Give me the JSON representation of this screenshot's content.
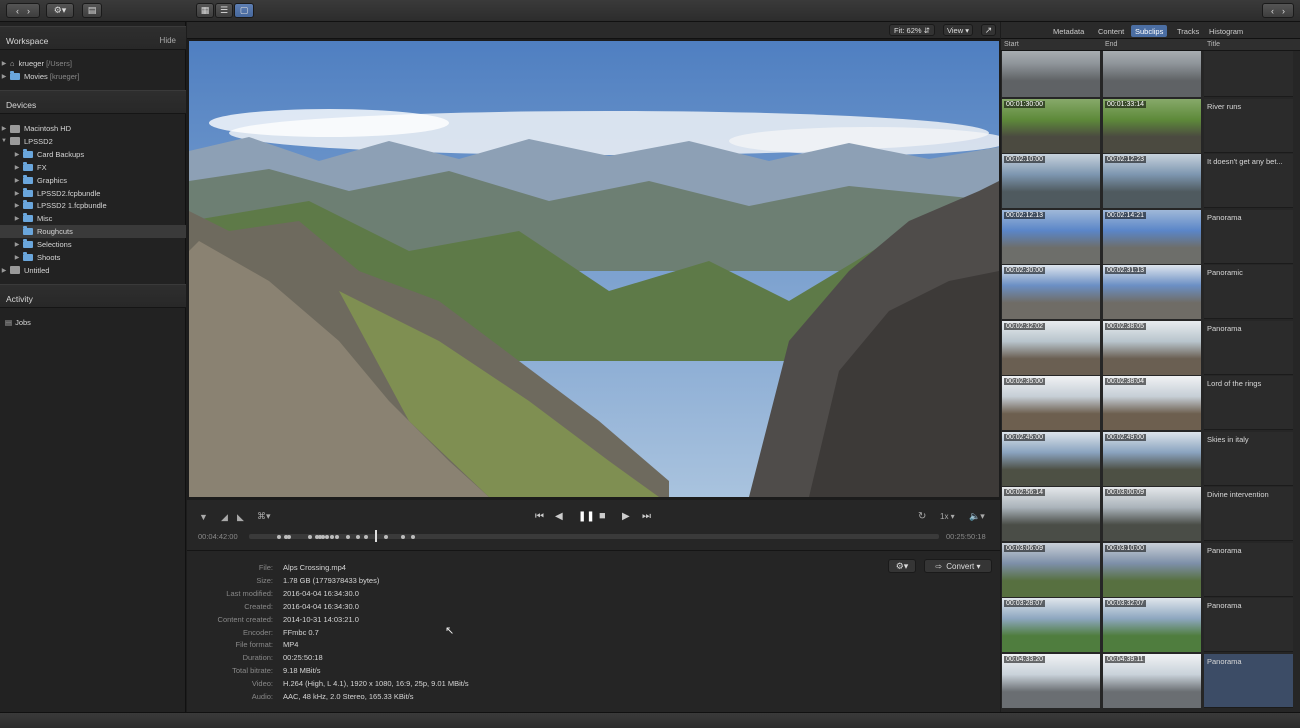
{
  "toolbar": {
    "view_buttons": [
      "grid-view",
      "list-view",
      "viewer-view"
    ]
  },
  "sidebar": {
    "workspace": {
      "title": "Workspace",
      "hide_label": "Hide",
      "items": [
        {
          "name": "krueger",
          "path": "[/Users]"
        },
        {
          "name": "Movies",
          "path": "[krueger]"
        }
      ]
    },
    "devices": {
      "title": "Devices",
      "items": [
        {
          "label": "Macintosh HD",
          "level": 0,
          "icon": "disk"
        },
        {
          "label": "LPSSD2",
          "level": 0,
          "icon": "disk"
        },
        {
          "label": "Card Backups",
          "level": 1,
          "icon": "folder"
        },
        {
          "label": "FX",
          "level": 1,
          "icon": "folder"
        },
        {
          "label": "Graphics",
          "level": 1,
          "icon": "folder"
        },
        {
          "label": "LPSSD2.fcpbundle",
          "level": 1,
          "icon": "folder"
        },
        {
          "label": "LPSSD2 1.fcpbundle",
          "level": 1,
          "icon": "folder"
        },
        {
          "label": "Misc",
          "level": 1,
          "icon": "folder"
        },
        {
          "label": "Roughcuts",
          "level": 1,
          "icon": "folder"
        },
        {
          "label": "Selections",
          "level": 1,
          "icon": "folder"
        },
        {
          "label": "Shoots",
          "level": 1,
          "icon": "folder"
        },
        {
          "label": "Untitled",
          "level": 0,
          "icon": "disk"
        }
      ]
    },
    "activity": {
      "title": "Activity"
    },
    "jobs": {
      "label": "Jobs"
    }
  },
  "viewer": {
    "fit_label": "Fit: 62%",
    "view_label": "View",
    "current_time": "00:04:42:00",
    "duration_time": "00:25:50:18",
    "speed_label": "1x",
    "playhead_fraction": 0.182
  },
  "file_info": {
    "convert_label": "Convert",
    "fields": [
      {
        "label": "File:",
        "value": "Alps Crossing.mp4"
      },
      {
        "label": "Size:",
        "value": "1.78 GB (1779378433 bytes)"
      },
      {
        "label": "Last modified:",
        "value": "2016-04-04 16:34:30.0"
      },
      {
        "label": "Created:",
        "value": "2016-04-04 16:34:30.0"
      },
      {
        "label": "Content created:",
        "value": "2014-10-31 14:03:21.0"
      },
      {
        "label": "Encoder:",
        "value": "FFmbc 0.7"
      },
      {
        "label": "File format:",
        "value": "MP4"
      },
      {
        "label": "Duration:",
        "value": "00:25:50:18"
      },
      {
        "label": "Total bitrate:",
        "value": "9.18 MBit/s"
      },
      {
        "label": "Video:",
        "value": "H.264 (High, L 4.1), 1920 x 1080, 16:9, 25p, 9.01 MBit/s"
      },
      {
        "label": "Audio:",
        "value": "AAC, 48 kHz, 2.0 Stereo, 165.33 KBit/s"
      }
    ]
  },
  "right_tabs": [
    "Metadata",
    "Content",
    "Subclips",
    "Tracks",
    "Histogram"
  ],
  "active_tab": "Subclips",
  "subclip_columns": {
    "start": "Start",
    "end": "End",
    "title": "Title"
  },
  "subclips": [
    {
      "start": "",
      "end": "",
      "title": ""
    },
    {
      "start": "00:01:30:00",
      "end": "00:01:33:14",
      "title": "River runs"
    },
    {
      "start": "00:02:10:00",
      "end": "00:02:12:23",
      "title": "It doesn't get any bet..."
    },
    {
      "start": "00:02:12:13",
      "end": "00:02:14:21",
      "title": "Panorama"
    },
    {
      "start": "00:02:30:00",
      "end": "00:02:31:13",
      "title": "Panoramic"
    },
    {
      "start": "00:02:32:02",
      "end": "00:02:38:05",
      "title": "Panorama"
    },
    {
      "start": "00:02:35:00",
      "end": "00:02:38:04",
      "title": "Lord of the rings"
    },
    {
      "start": "00:02:45:00",
      "end": "00:02:49:00",
      "title": "Skies in italy"
    },
    {
      "start": "00:02:56:14",
      "end": "00:03:00:09",
      "title": "Divine intervention"
    },
    {
      "start": "00:03:06:09",
      "end": "00:03:10:00",
      "title": "Panorama"
    },
    {
      "start": "00:03:28:07",
      "end": "00:03:32:07",
      "title": "Panorama"
    },
    {
      "start": "00:04:33:20",
      "end": "00:04:39:11",
      "title": "Panorama"
    }
  ],
  "colors": {
    "accent": "#4b6ea3",
    "folder": "#6aa6dc"
  }
}
